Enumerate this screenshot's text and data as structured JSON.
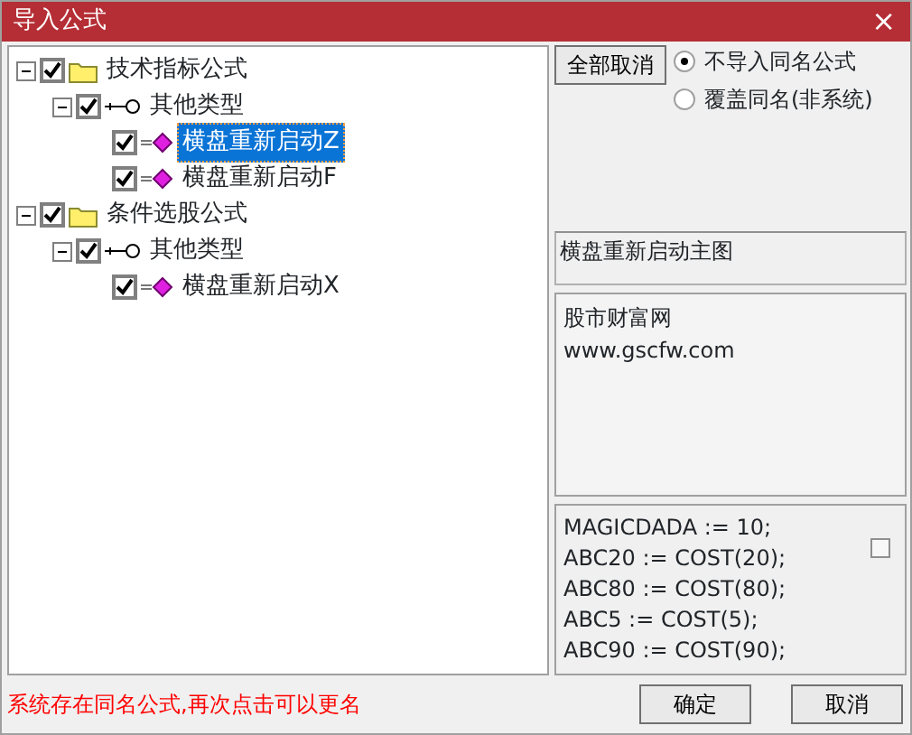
{
  "window": {
    "title": "导入公式",
    "close": "×"
  },
  "tree": [
    {
      "label": "技术指标公式",
      "kind": "folder",
      "checked": true,
      "expanded": true,
      "selected": false,
      "children": [
        {
          "label": "其他类型",
          "kind": "group",
          "checked": true,
          "expanded": true,
          "selected": false,
          "children": [
            {
              "label": "横盘重新启动Z",
              "kind": "formula",
              "checked": true,
              "selected": true
            },
            {
              "label": "横盘重新启动F",
              "kind": "formula",
              "checked": true,
              "selected": false
            }
          ]
        }
      ]
    },
    {
      "label": "条件选股公式",
      "kind": "folder",
      "checked": true,
      "expanded": true,
      "selected": false,
      "children": [
        {
          "label": "其他类型",
          "kind": "group",
          "checked": true,
          "expanded": true,
          "selected": false,
          "children": [
            {
              "label": "横盘重新启动X",
              "kind": "formula",
              "checked": true,
              "selected": false
            }
          ]
        }
      ]
    }
  ],
  "cancel_all_button": "全部取消",
  "options": [
    {
      "label": "不导入同名公式",
      "selected": true
    },
    {
      "label": "覆盖同名(非系统)",
      "selected": false
    }
  ],
  "formula_name": "横盘重新启动主图",
  "description": [
    "股市财富网",
    "www.gscfw.com"
  ],
  "code_lines": [
    "MAGICDADA := 10;",
    "ABC20 := COST(20);",
    "ABC80 := COST(80);",
    "ABC5 := COST(5);",
    "ABC90 := COST(90);"
  ],
  "code_checkbox": {
    "checked": false
  },
  "status_message": "系统存在同名公式,再次点击可以更名",
  "buttons": [
    "确定",
    "取消"
  ]
}
